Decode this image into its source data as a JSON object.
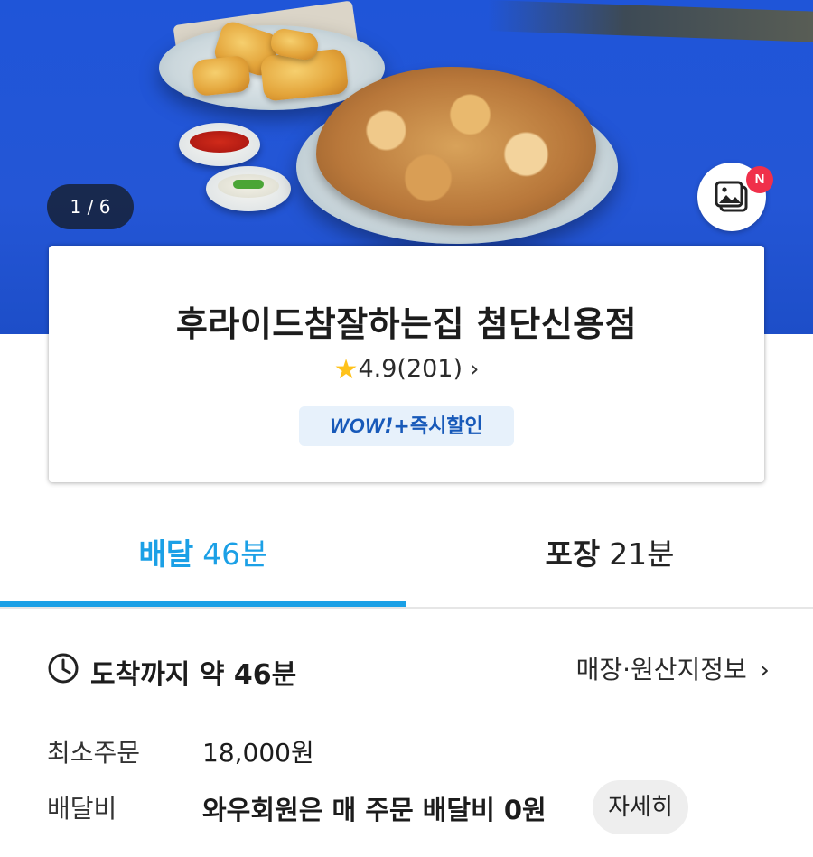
{
  "hero": {
    "page_counter": "1 / 6",
    "gallery_badge": "N"
  },
  "store": {
    "name": "후라이드참잘하는집 첨단신용점",
    "rating": "4.9",
    "review_count": "(201)",
    "badge_wow": "WOW",
    "badge_bang": "!",
    "badge_text": "+즉시할인"
  },
  "tabs": [
    {
      "label": "배달",
      "time": "46분",
      "active": true
    },
    {
      "label": "포장",
      "time": "21분",
      "active": false
    }
  ],
  "info": {
    "eta": "도착까지 약 46분",
    "store_info_link": "매장·원산지정보",
    "min_order_label": "최소주문",
    "min_order_value": "18,000원",
    "delivery_fee_label": "배달비",
    "delivery_fee_value": "와우회원은 매 주문 배달비 0원",
    "detail_button": "자세히"
  },
  "colors": {
    "accent": "#1ba0e6",
    "hero_bg": "#2456d6",
    "badge_bg": "#e7f1fb",
    "badge_text": "#1759b9",
    "new_badge": "#f0304a",
    "star": "#ffc21a"
  },
  "icons": {
    "star": "star-icon",
    "chevron": "chevron-right-icon",
    "clock": "clock-icon",
    "gallery": "photo-gallery-icon"
  }
}
